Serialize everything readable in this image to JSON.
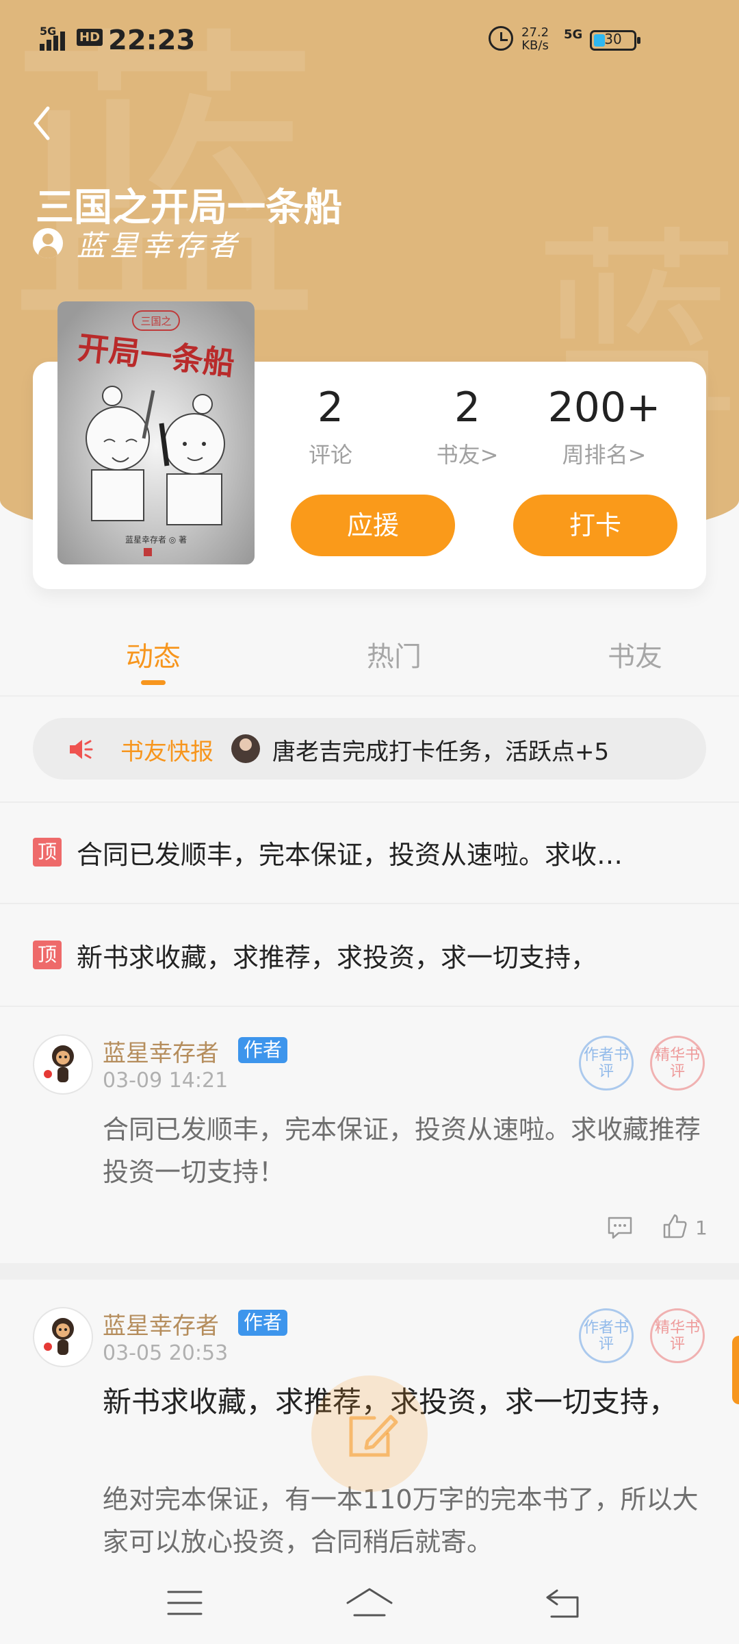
{
  "status_bar": {
    "signal": "5G",
    "hd": "HD",
    "time": "22:23",
    "speed_value": "27.2",
    "speed_unit": "KB/s",
    "network": "5G",
    "battery": "30"
  },
  "header": {
    "watermark": "蓝",
    "title": "三国之开局一条船",
    "author": "蓝星幸存者"
  },
  "stats": [
    {
      "value": "2",
      "label": "评论"
    },
    {
      "value": "2",
      "label": "书友>"
    },
    {
      "value": "200+",
      "label": "周排名>"
    }
  ],
  "buttons": {
    "support": "应援",
    "checkin": "打卡"
  },
  "tabs": [
    {
      "label": "动态",
      "active": true
    },
    {
      "label": "热门",
      "active": false
    },
    {
      "label": "书友",
      "active": false
    }
  ],
  "ticker": {
    "label": "书友快报",
    "text": "唐老吉完成打卡任务，活跃点+5"
  },
  "pinned": [
    {
      "badge": "顶",
      "text": "合同已发顺丰，完本保证，投资从速啦。求收…"
    },
    {
      "badge": "顶",
      "text": "新书求收藏，求推荐，求投资，求一切支持，"
    }
  ],
  "posts": [
    {
      "user": "蓝星幸存者",
      "tag": "作者",
      "time": "03-09 14:21",
      "stamp_blue": "作者书评",
      "stamp_red": "精华书评",
      "text": "合同已发顺丰，完本保证，投资从速啦。求收藏推荐投资一切支持！",
      "likes": "1"
    },
    {
      "user": "蓝星幸存者",
      "tag": "作者",
      "time": "03-05 20:53",
      "stamp_blue": "作者书评",
      "stamp_red": "精华书评",
      "headline": "新书求收藏，求推荐，求投资，求一切支持，",
      "text": "绝对完本保证，有一本110万字的完本书了，所以大家可以放心投资，合同稍后就寄。"
    }
  ],
  "cover": {
    "series": "三国之",
    "title": "开局一条船",
    "author": "蓝星幸存者 ◎ 著"
  },
  "icons": {
    "back": "back-arrow-icon",
    "speaker": "speaker-icon",
    "comment": "comment-icon",
    "like": "thumbs-up-icon",
    "fab": "edit-icon"
  },
  "colors": {
    "header": "#dfb77c",
    "accent": "#f7961e",
    "tag": "#3d95ec",
    "pin": "#ee6a6a"
  }
}
